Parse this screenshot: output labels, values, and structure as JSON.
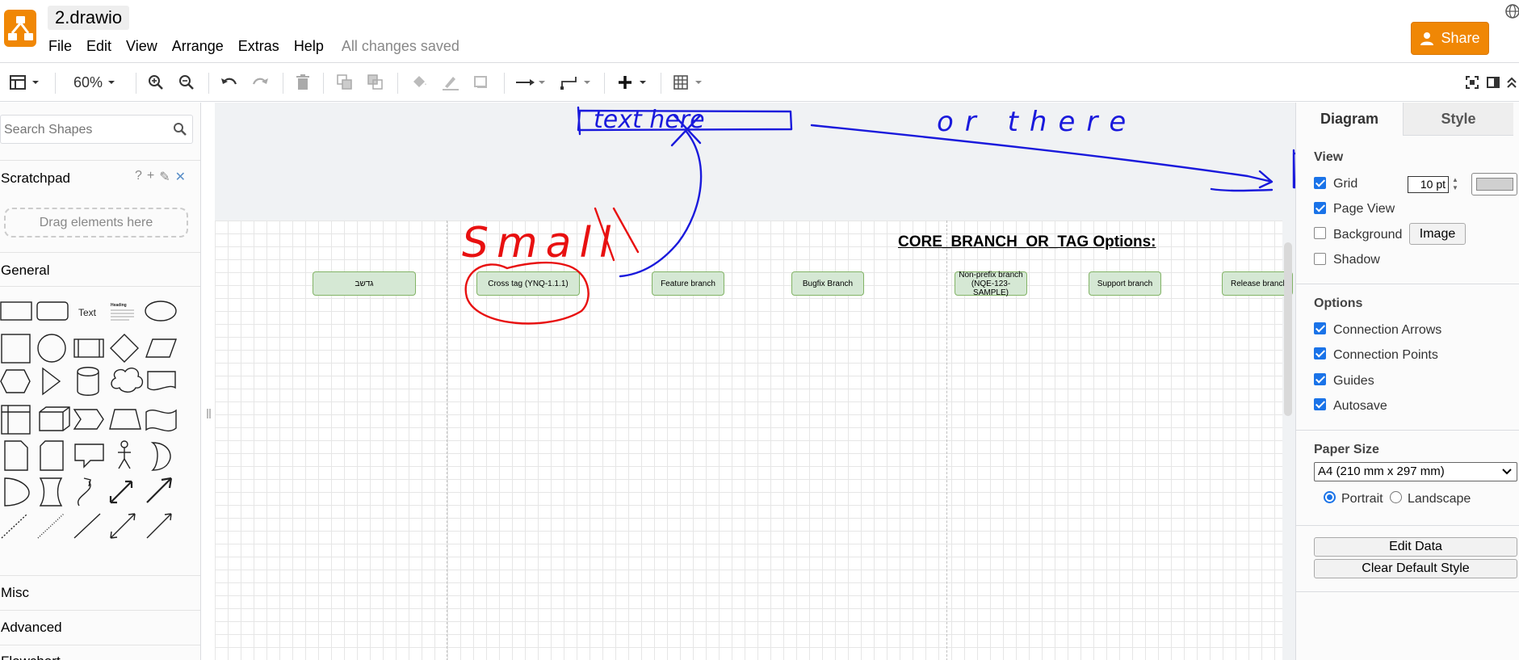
{
  "app": {
    "file_title": "2.drawio",
    "save_status": "All changes saved",
    "share_label": "Share",
    "accent_color": "#f08705"
  },
  "menu": [
    "File",
    "Edit",
    "View",
    "Arrange",
    "Extras",
    "Help"
  ],
  "toolbar": {
    "zoom": "60%",
    "icons": [
      "layout-icon",
      "zoom-in-icon",
      "zoom-out-icon",
      "undo-icon",
      "redo-icon",
      "delete-icon",
      "to-front-icon",
      "to-back-icon",
      "fill-color-icon",
      "line-color-icon",
      "shadow-icon",
      "connection-icon",
      "waypoints-icon",
      "insert-icon",
      "table-icon",
      "fullscreen-icon",
      "format-panel-icon",
      "collapse-icon"
    ]
  },
  "left_panel": {
    "search_placeholder": "Search Shapes",
    "scratchpad_title": "Scratchpad",
    "scratchpad_icons": [
      "?",
      "+",
      "✎",
      "✕"
    ],
    "drop_hint": "Drag elements here",
    "general_title": "General",
    "text_shape_label": "Text",
    "heading_shape_label": "Heading",
    "sections": [
      "Misc",
      "Advanced",
      "Flowchart"
    ]
  },
  "canvas": {
    "diagram_title": "CORE_BRANCH_OR_TAG Options:",
    "branches": [
      {
        "label": "גדשב"
      },
      {
        "label": "Cross tag (YNQ-1.1.1)"
      },
      {
        "label": "Feature branch"
      },
      {
        "label": "Bugfix Branch"
      },
      {
        "label": "Non-prefix branch\n(NQE-123-SAMPLE)"
      },
      {
        "label": "Support branch"
      },
      {
        "label": "Release branch"
      }
    ],
    "annotations": {
      "blue_text_1": "text here",
      "blue_text_2": "or there",
      "blue_text_3": "text",
      "red_text": "Small",
      "blue_color": "#1a1adc",
      "red_color": "#e81010"
    }
  },
  "right_panel": {
    "tabs": [
      "Diagram",
      "Style"
    ],
    "view_section": "View",
    "view_options": [
      {
        "label": "Grid",
        "checked": true
      },
      {
        "label": "Page View",
        "checked": true
      },
      {
        "label": "Background",
        "checked": false
      },
      {
        "label": "Shadow",
        "checked": false
      }
    ],
    "grid_size": "10 pt",
    "image_button": "Image",
    "options_section": "Options",
    "options": [
      {
        "label": "Connection Arrows",
        "checked": true
      },
      {
        "label": "Connection Points",
        "checked": true
      },
      {
        "label": "Guides",
        "checked": true
      },
      {
        "label": "Autosave",
        "checked": true
      }
    ],
    "paper_size_section": "Paper Size",
    "paper_size_value": "A4 (210 mm x 297 mm)",
    "orientation": [
      {
        "label": "Portrait",
        "checked": true
      },
      {
        "label": "Landscape",
        "checked": false
      }
    ],
    "edit_data_button": "Edit Data",
    "clear_style_button": "Clear Default Style"
  }
}
